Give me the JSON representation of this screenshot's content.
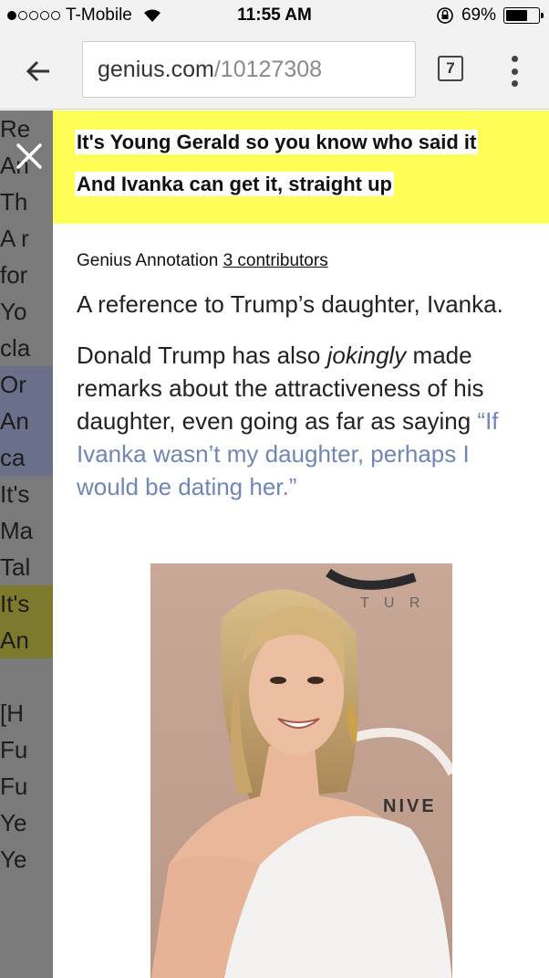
{
  "status": {
    "carrier": "T-Mobile",
    "time": "11:55 AM",
    "battery_percent": "69%",
    "battery_level": 0.69
  },
  "browser": {
    "url_domain": "genius.com",
    "url_path": "/10127308",
    "tab_count": "7"
  },
  "background_lines": [
    "Re",
    "An",
    "Th",
    "A r",
    "for",
    "Yo",
    "cla",
    "Or",
    "An",
    "ca",
    "It's",
    "Ma",
    "Tal",
    "It's",
    "An",
    "",
    "[H",
    "Fu",
    "Fu",
    "Ye",
    "Ye"
  ],
  "lyric": {
    "line1": "It's Young Gerald so you know who said it",
    "line2": "And Ivanka can get it, straight up"
  },
  "annotation": {
    "label": "Genius Annotation",
    "contributors": "3 contributors",
    "para1": "A reference to Trump’s daughter, Ivanka.",
    "para2_start": "Donald Trump has also ",
    "para2_emph": "jokingly",
    "para2_mid": " made remarks about the attractiveness of his daughter, even going as far as saying ",
    "para2_quote": "“If Ivanka wasn’t my daughter, perhaps I would be dating her.”"
  },
  "photo": {
    "backdrop_text_1": "T U R",
    "backdrop_text_2": "NIVE"
  },
  "colors": {
    "highlight_yellow": "#fffe57",
    "quote_blue": "#6f86b6",
    "dim_overlay": "#7a7a7a"
  }
}
